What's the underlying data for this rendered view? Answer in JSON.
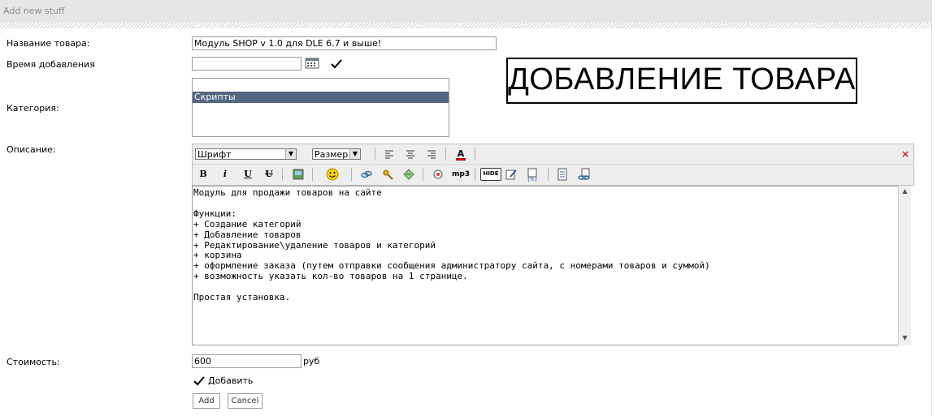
{
  "header": {
    "title": "Add new stuff"
  },
  "form": {
    "name_label": "Название товара:",
    "name_value": "Модуль SHOP v 1.0 для DLE 6.7 и выше!",
    "time_label": "Время добавления",
    "time_value": "",
    "category_label": "Категория:",
    "category_options": [
      "Скрипты"
    ],
    "description_label": "Описание:",
    "price_label": "Стоимость:",
    "price_value": "600",
    "currency": "руб",
    "add_checkbox_label": "Добавить",
    "add_button": "Add",
    "cancel_button": "Cancel"
  },
  "banner": {
    "text": "ДОБАВЛЕНИЕ ТОВАРА"
  },
  "editor": {
    "font_select": "Шрифт",
    "size_select": "Размер",
    "toolbar_row1_icons": [
      "align-left-icon",
      "align-center-icon",
      "align-right-icon",
      "font-color-icon",
      "close-icon"
    ],
    "toolbar_row2_icons": [
      "bold-icon",
      "italic-icon",
      "underline-icon",
      "strike-icon",
      "image-icon",
      "smiley-icon",
      "link-icon",
      "leech-icon",
      "email-icon",
      "video-icon",
      "mp3-icon",
      "hide-icon",
      "quote-icon",
      "code-icon",
      "pagebreak-icon",
      "page-link-icon"
    ],
    "mp3_label": "mp3",
    "hide_label": "HIDE",
    "text": "Модуль для продажи товаров на сайте\n\nФункции:\n+ Создание категорий\n+ Добавление товаров\n+ Редактирование\\удаление товаров и категорий\n+ корзина\n+ оформление заказа (путем отправки сообщения администратору сайта, с номерами товаров и суммой)\n+ возможность указать кол-во товаров на 1 странице.\n\nПростая установка."
  },
  "colors": {
    "selected_option_bg": "#536782",
    "header_bg": "#e6e6e6",
    "font_color_icon": "#cc0000"
  }
}
